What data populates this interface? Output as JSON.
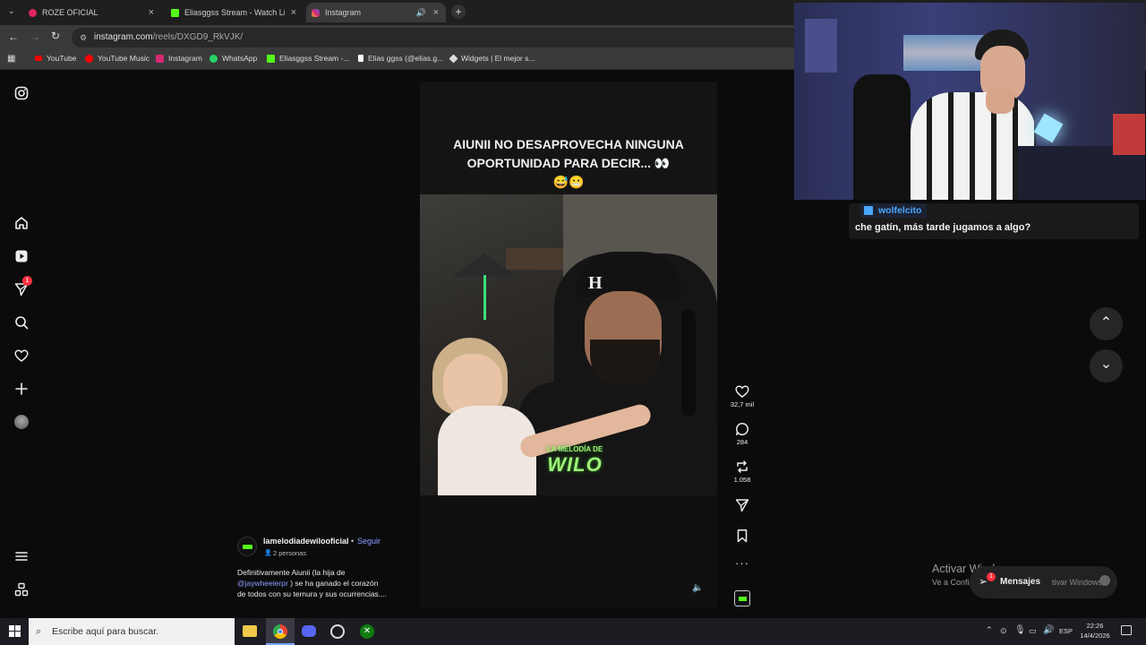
{
  "browser": {
    "tabs": [
      {
        "label": "ROZE OFICIAL",
        "color": "#e0245e"
      },
      {
        "label": "Eliasggss Stream - Watch Live o",
        "color": "#53fc18"
      },
      {
        "label": "Instagram",
        "color": "#d62976"
      }
    ],
    "url_host": "instagram.com",
    "url_path": "/reels/DXGD9_RkVJK/",
    "bookmarks": [
      {
        "label": "YouTube",
        "color": "#ff0000"
      },
      {
        "label": "YouTube Music",
        "color": "#ff0000"
      },
      {
        "label": "Instagram",
        "color": "#d62976"
      },
      {
        "label": "WhatsApp",
        "color": "#25d366"
      },
      {
        "label": "Eliasggss Stream -...",
        "color": "#53fc18"
      },
      {
        "label": "Elias ggss (@elias.g...",
        "color": "#ffffff"
      },
      {
        "label": "Widgets | El mejor s...",
        "color": "#dddddd"
      }
    ]
  },
  "sidebar": {
    "notification_count": "1",
    "icons": [
      "instagram-logo-icon",
      "home-icon",
      "reels-icon",
      "messages-icon",
      "search-icon",
      "heart-icon",
      "create-icon",
      "profile-avatar",
      "menu-icon",
      "more-apps-icon"
    ]
  },
  "reel": {
    "caption_line1": "AIUNII NO DESAPROVECHA NINGUNA",
    "caption_line2": "OPORTUNIDAD PARA DECIR... 👀",
    "caption_line3": "😅😬",
    "watermark": "LA MELODÍA DE WILO",
    "author": "lamelodiadewilooficial",
    "separator": "•",
    "follow": "Seguir",
    "audience": "2 personas",
    "description_1": "Definitivamente Aiunii (la hija de",
    "mention": "@jaywheelerpr",
    "description_2": " ) se ha ganado el corazón",
    "description_3": "de todos con su ternura y sus ocurrencias...."
  },
  "actions": {
    "likes": "32,7 mil",
    "comments": "284",
    "reposts": "1.058"
  },
  "chat": {
    "username": "wolfelcito",
    "message": "che gatín, más tarde jugamos a algo?"
  },
  "watermark": {
    "title": "Activar Windows",
    "subtitle_start": "Ve a Config",
    "subtitle_end": "tivar Windows."
  },
  "messages_widget": {
    "label": "Mensajes",
    "badge": "1"
  },
  "taskbar": {
    "search_placeholder": "Escribe aquí para buscar.",
    "lang": "ESP",
    "time": "22:26",
    "date": "14/4/2026"
  },
  "colors": {
    "link_blue": "#8f9bff",
    "kick_green": "#53fc18",
    "notification_red": "#ff3040"
  }
}
